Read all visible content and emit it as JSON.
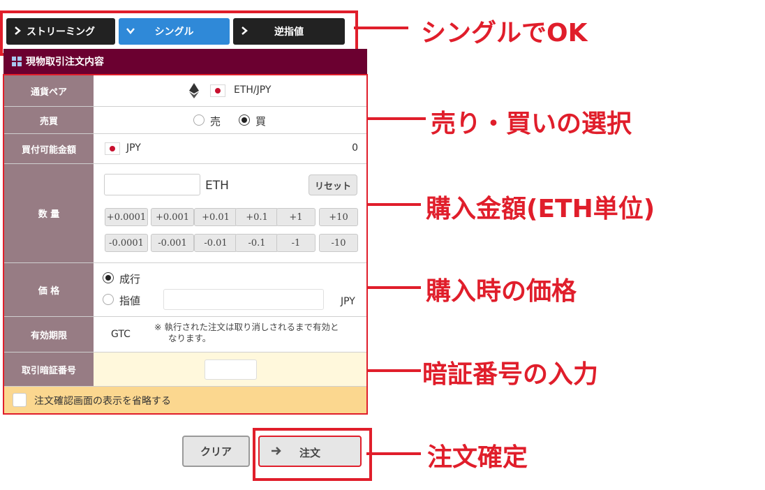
{
  "tabs": [
    {
      "label": "ストリーミング",
      "icon": "chevron-right-icon"
    },
    {
      "label": "シングル",
      "icon": "chevron-down-icon",
      "active": true
    },
    {
      "label": "逆指値",
      "icon": "chevron-right-icon"
    }
  ],
  "panel": {
    "title": "現物取引注文内容"
  },
  "pair": {
    "label": "通貨ペア",
    "value": "ETH/JPY"
  },
  "side": {
    "label": "売買",
    "sell": "売",
    "buy": "買",
    "selected": "買"
  },
  "available": {
    "label": "買付可能金額",
    "currency": "JPY",
    "amount": "0"
  },
  "quantity": {
    "label": "数 量",
    "unit": "ETH",
    "value": "",
    "reset": "リセット",
    "plus": [
      "+0.0001",
      "+0.001",
      "+0.01",
      "+0.1",
      "+1",
      "+10"
    ],
    "minus": [
      "-0.0001",
      "-0.001",
      "-0.01",
      "-0.1",
      "-1",
      "-10"
    ]
  },
  "price": {
    "label": "価 格",
    "market": "成行",
    "limit": "指値",
    "unit": "JPY",
    "selected": "成行",
    "value": ""
  },
  "expiry": {
    "label": "有効期限",
    "value": "GTC",
    "note_line1": "※ 執行された注文は取り消しされるまで有効と",
    "note_line2": "なります。"
  },
  "pin": {
    "label": "取引暗証番号",
    "value": ""
  },
  "skip_confirm": {
    "label": "注文確認画面の表示を省略する",
    "checked": false
  },
  "buttons": {
    "clear": "クリア",
    "order": "注文"
  },
  "annotations": {
    "single_ok": "シングルでOK",
    "side": "売り・買いの選択",
    "amount": "購入金額(ETH単位)",
    "price": "購入時の価格",
    "pin": "暗証番号の入力",
    "confirm": "注文確定"
  },
  "colors": {
    "accent": "#e01e2b",
    "header": "#6b0030",
    "label_bg": "#977c84",
    "active_tab": "#2f89d8",
    "pin_row": "#fff8dc",
    "skip_row": "#fbd78f"
  }
}
